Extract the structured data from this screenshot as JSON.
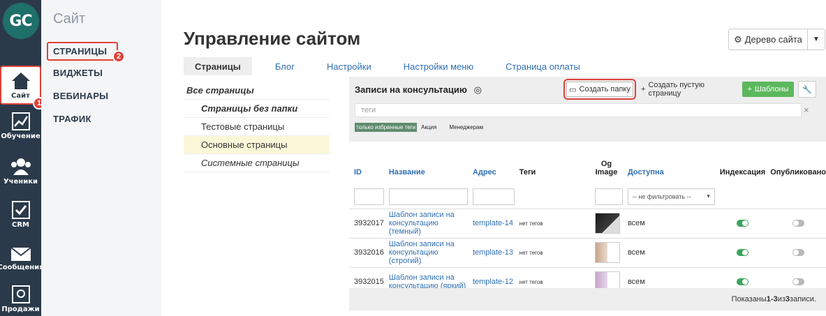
{
  "logo": {
    "text": "GC"
  },
  "rail": {
    "items": [
      {
        "label": "Сайт",
        "icon": "home-icon"
      },
      {
        "label": "Обучение",
        "icon": "chart-icon"
      },
      {
        "label": "Ученики",
        "icon": "users-icon"
      },
      {
        "label": "CRM",
        "icon": "checkbox-icon"
      },
      {
        "label": "Сообщения",
        "icon": "envelope-icon"
      },
      {
        "label": "Продажи",
        "icon": "safe-icon"
      }
    ],
    "badge1": "1",
    "badge2": "2"
  },
  "subnav": {
    "title": "Сайт",
    "items": [
      "СТРАНИЦЫ",
      "ВИДЖЕТЫ",
      "ВЕБИНАРЫ",
      "ТРАФИК"
    ]
  },
  "header": {
    "title": "Управление сайтом",
    "tree_button": "Дерево сайта"
  },
  "tabs": [
    "Страницы",
    "Блог",
    "Настройки",
    "Настройки меню",
    "Страница оплаты"
  ],
  "folders": [
    "Все страницы",
    "Страницы без папки",
    "Тестовые страницы",
    "Основные страницы",
    "Системные страницы"
  ],
  "panel": {
    "title": "Записи на консультацию",
    "create_folder": "Создать папку",
    "create_empty": "Создать пустую страницу",
    "templates": "Шаблоны",
    "tags_placeholder": "теги",
    "tags_clear": "×",
    "chips": [
      "только избранные теги",
      "Акция",
      "Менеджерам"
    ]
  },
  "table": {
    "headers": {
      "id": "ID",
      "name": "Название",
      "address": "Адрес",
      "tags": "Теги",
      "og": "Og Image",
      "access": "Доступна",
      "indexing": "Индексация",
      "published": "Опубликовано"
    },
    "filter_select": "-- не фильтровать --",
    "rows": [
      {
        "id": "3932017",
        "name": "Шаблон записи на консультацию (темный)",
        "address": "template-14",
        "tags": "нет тегов",
        "access": "всем"
      },
      {
        "id": "3932016",
        "name": "Шаблон записи на консультацию (строгий)",
        "address": "template-13",
        "tags": "нет тегов",
        "access": "всем"
      },
      {
        "id": "3932015",
        "name": "Шаблон записи на консультацию (яркий)",
        "address": "template-12",
        "tags": "нет тегов",
        "access": "всем"
      }
    ],
    "footer_prefix": "Показаны ",
    "footer_range": "1-3",
    "footer_mid": " из ",
    "footer_total": "3",
    "footer_suffix": " записи."
  }
}
